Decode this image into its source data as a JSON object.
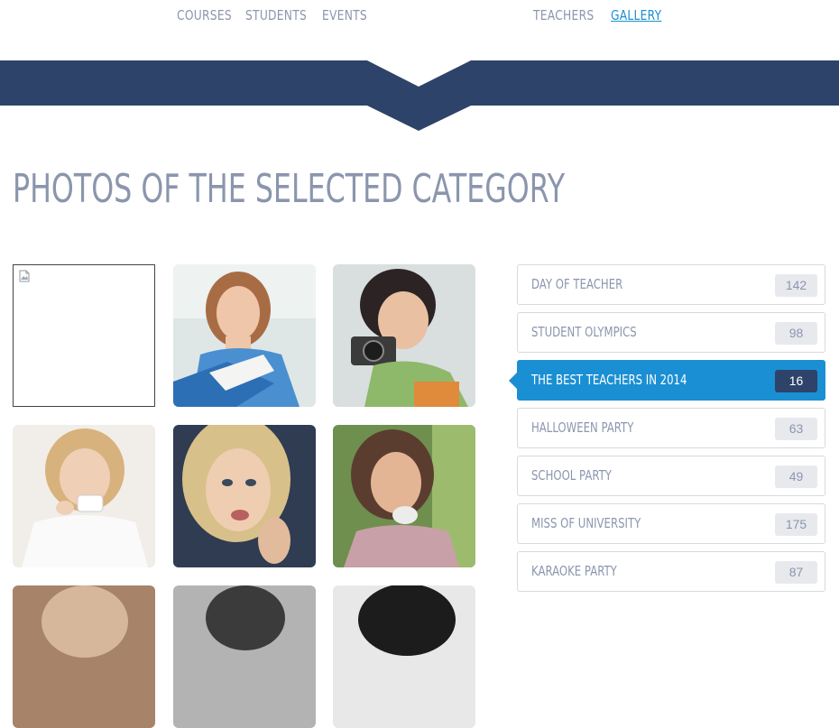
{
  "nav": {
    "items": [
      {
        "label": "Courses",
        "active": false
      },
      {
        "label": "Students",
        "active": false
      },
      {
        "label": "Events",
        "active": false
      },
      {
        "label": "Teachers",
        "active": false
      },
      {
        "label": "Gallery",
        "active": true
      }
    ]
  },
  "page_title": "Photos of the selected category",
  "gallery": {
    "photos": [
      {
        "subject": "broken-image"
      },
      {
        "subject": "girl reading a blue book"
      },
      {
        "subject": "woman holding a camera"
      },
      {
        "subject": "woman drinking from a cup"
      },
      {
        "subject": "blonde woman close-up"
      },
      {
        "subject": "woman outdoors"
      },
      {
        "subject": "portrait (partially visible)"
      },
      {
        "subject": "portrait (partially visible)"
      },
      {
        "subject": "portrait (partially visible)"
      }
    ]
  },
  "categories": [
    {
      "label": "Day of teacher",
      "count": "142",
      "active": false
    },
    {
      "label": "Student Olympics",
      "count": "98",
      "active": false
    },
    {
      "label": "The best teachers in 2014",
      "count": "16",
      "active": true
    },
    {
      "label": "Halloween party",
      "count": "63",
      "active": false
    },
    {
      "label": "School party",
      "count": "49",
      "active": false
    },
    {
      "label": "Miss of University",
      "count": "175",
      "active": false
    },
    {
      "label": "Karaoke party",
      "count": "87",
      "active": false
    }
  ],
  "colors": {
    "navy": "#2d4369",
    "accent": "#1b8fd3",
    "muted_text": "#8b96ad",
    "badge_bg": "#e7e9ed"
  },
  "icons": {
    "broken_image": "broken-image-icon"
  }
}
